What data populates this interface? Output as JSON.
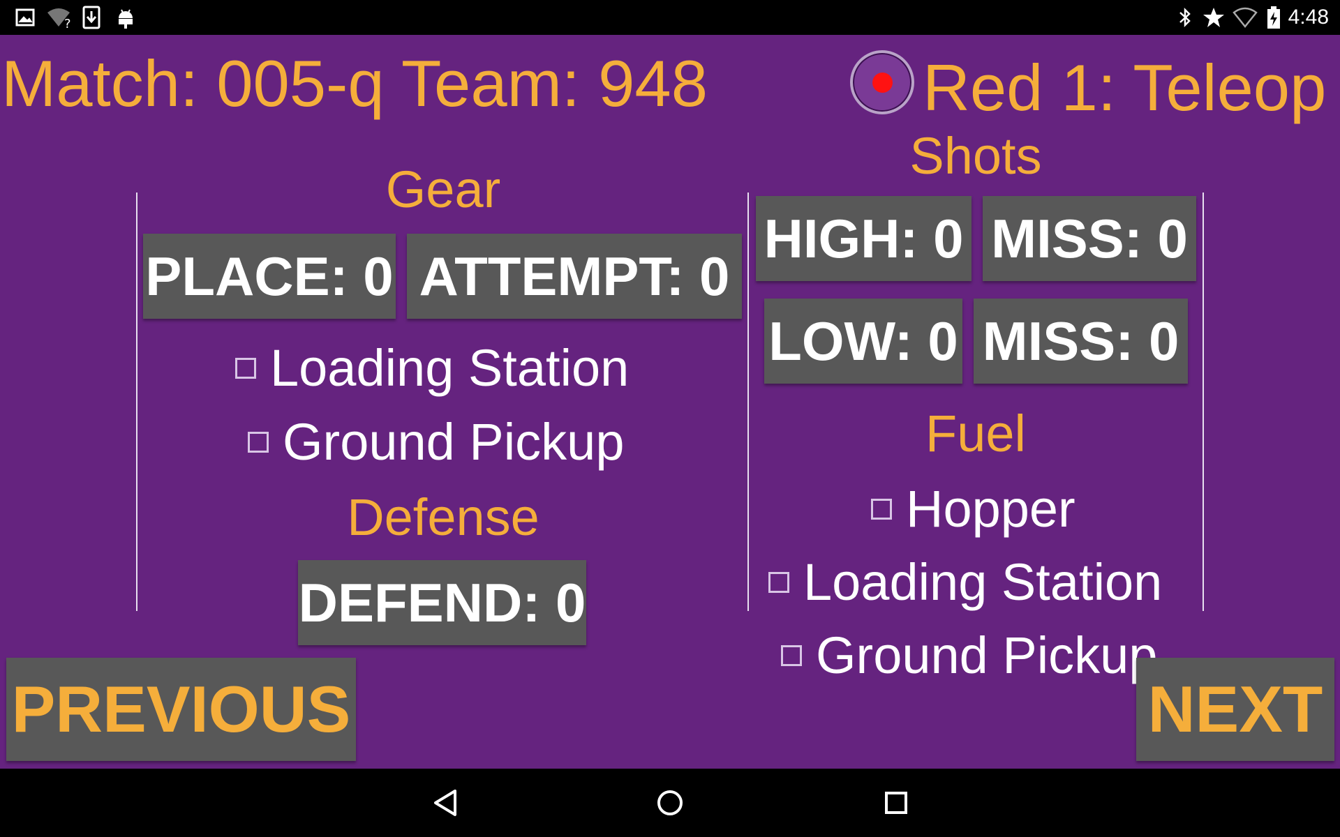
{
  "status_bar": {
    "left_icons": [
      "image-icon",
      "wifi-unknown-icon",
      "download-icon",
      "android-debug-icon"
    ],
    "right_icons": [
      "bluetooth-icon",
      "star-icon",
      "wifi-icon",
      "battery-charging-icon"
    ],
    "time": "4:48"
  },
  "header": {
    "match_team": "Match: 005-q Team: 948",
    "position_mode": "Red 1: Teleop"
  },
  "gear": {
    "title": "Gear",
    "place_button": "PLACE: 0",
    "attempt_button": "ATTEMPT: 0",
    "loading_station": "Loading Station",
    "ground_pickup": "Ground Pickup"
  },
  "defense": {
    "title": "Defense",
    "defend_button": "DEFEND: 0"
  },
  "shots": {
    "title": "Shots",
    "high_button": "HIGH: 0",
    "high_miss_button": "MISS: 0",
    "low_button": "LOW: 0",
    "low_miss_button": "MISS: 0"
  },
  "fuel": {
    "title": "Fuel",
    "hopper": "Hopper",
    "loading_station": "Loading Station",
    "ground_pickup": "Ground Pickup"
  },
  "nav": {
    "previous": "PREVIOUS",
    "next": "NEXT"
  },
  "colors": {
    "background": "#65237f",
    "accent": "#f5ae3b",
    "button": "#585858",
    "record": "#ff1212"
  }
}
